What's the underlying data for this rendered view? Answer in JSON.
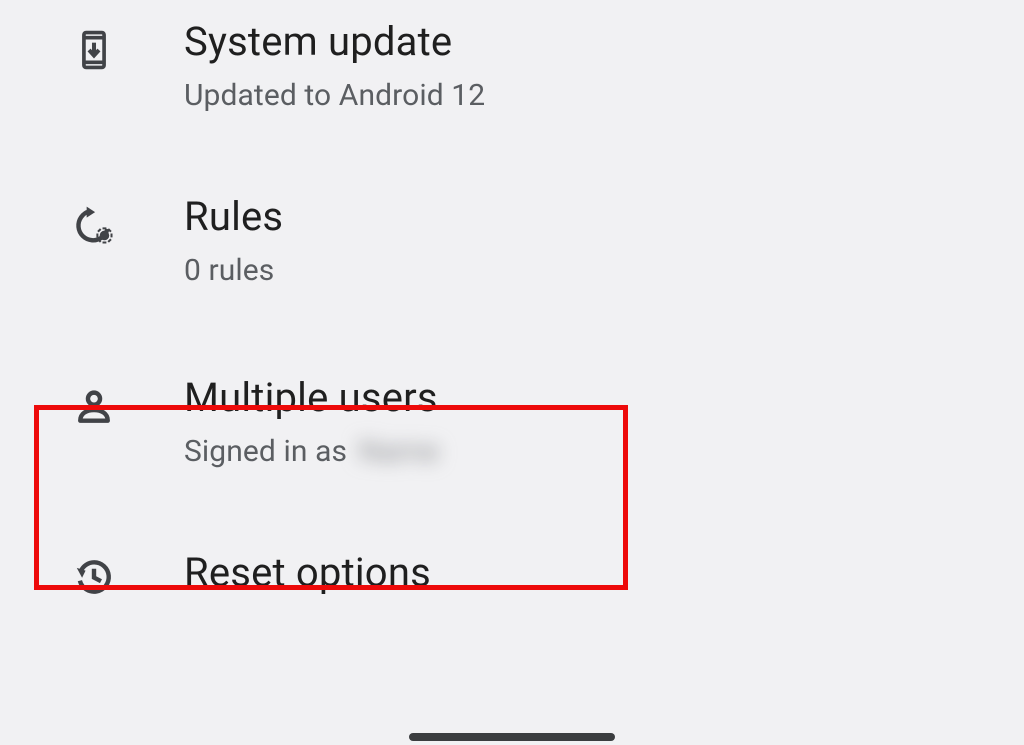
{
  "items": [
    {
      "title": "System update",
      "subtitle": "Updated to Android 12"
    },
    {
      "title": "Rules",
      "subtitle": "0 rules"
    },
    {
      "title": "Multiple users",
      "subtitle_prefix": "Signed in as ",
      "subtitle_user": "Name"
    },
    {
      "title": "Reset options"
    }
  ]
}
